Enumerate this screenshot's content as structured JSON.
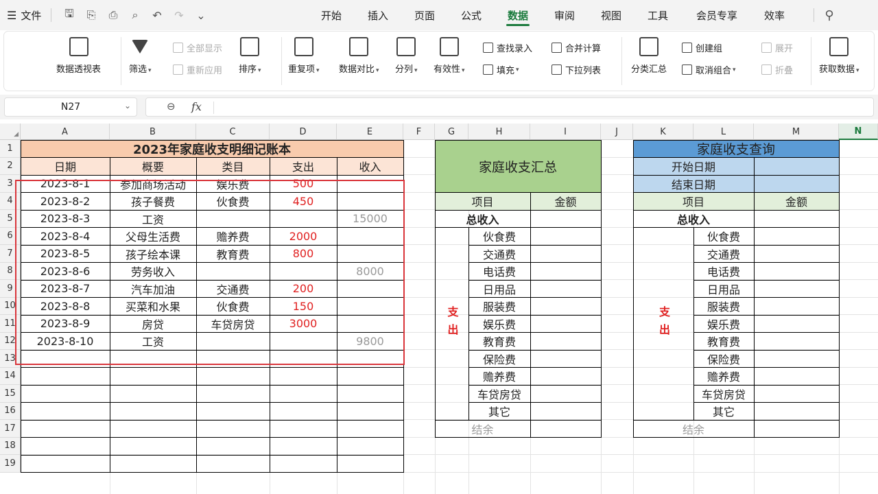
{
  "menubar": {
    "menu_label": "文件",
    "tabs": [
      "开始",
      "插入",
      "页面",
      "公式",
      "数据",
      "审阅",
      "视图",
      "工具",
      "会员专享",
      "效率"
    ],
    "active_tab": "数据"
  },
  "ribbon": {
    "pivot": "数据透视表",
    "filter": "筛选",
    "show_all": "全部显示",
    "reapply": "重新应用",
    "sort": "排序",
    "duplicates": "重复项",
    "compare": "数据对比",
    "split": "分列",
    "validity": "有效性",
    "lookup": "查找录入",
    "fill": "填充",
    "consolidate": "合并计算",
    "dropdown": "下拉列表",
    "subtotal": "分类汇总",
    "group": "创建组",
    "ungroup": "取消组合",
    "expand": "展开",
    "collapse": "折叠",
    "get_data": "获取数据"
  },
  "formula_bar": {
    "name_box": "N27",
    "fx": "fx",
    "formula": ""
  },
  "columns": [
    "A",
    "B",
    "C",
    "D",
    "E",
    "F",
    "G",
    "H",
    "I",
    "J",
    "K",
    "L",
    "M",
    "N"
  ],
  "selected_column": "N",
  "rows": [
    "1",
    "2",
    "3",
    "4",
    "5",
    "6",
    "7",
    "8",
    "9",
    "10",
    "11",
    "12",
    "13",
    "14",
    "15",
    "16",
    "17",
    "18",
    "19"
  ],
  "ledger": {
    "title": "2023年家庭收支明细记账本",
    "headers": [
      "日期",
      "概要",
      "类目",
      "支出",
      "收入"
    ],
    "entries": [
      [
        "2023-8-1",
        "参加商场活动",
        "娱乐费",
        "500",
        ""
      ],
      [
        "2023-8-2",
        "孩子餐费",
        "伙食费",
        "450",
        ""
      ],
      [
        "2023-8-3",
        "工资",
        "",
        "",
        "15000"
      ],
      [
        "2023-8-4",
        "父母生活费",
        "赡养费",
        "2000",
        ""
      ],
      [
        "2023-8-5",
        "孩子绘本课",
        "教育费",
        "800",
        ""
      ],
      [
        "2023-8-6",
        "劳务收入",
        "",
        "",
        "8000"
      ],
      [
        "2023-8-7",
        "汽车加油",
        "交通费",
        "200",
        ""
      ],
      [
        "2023-8-8",
        "买菜和水果",
        "伙食费",
        "150",
        ""
      ],
      [
        "2023-8-9",
        "房贷",
        "车贷房贷",
        "3000",
        ""
      ],
      [
        "2023-8-10",
        "工资",
        "",
        "",
        "9800"
      ]
    ]
  },
  "summary": {
    "title": "家庭收支汇总",
    "col_item": "项目",
    "col_amount": "金额",
    "total_income": "总收入",
    "expense_label": "支出",
    "categories": [
      "伙食费",
      "交通费",
      "电话费",
      "日用品",
      "服装费",
      "娱乐费",
      "教育费",
      "保险费",
      "赡养费",
      "车贷房贷",
      "其它"
    ],
    "balance": "结余"
  },
  "query": {
    "title": "家庭收支查询",
    "start_date": "开始日期",
    "end_date": "结束日期",
    "col_item": "项目",
    "col_amount": "金额",
    "total_income": "总收入",
    "expense_label": "支出",
    "categories": [
      "伙食费",
      "交通费",
      "电话费",
      "日用品",
      "服装费",
      "娱乐费",
      "教育费",
      "保险费",
      "赡养费",
      "车贷房贷",
      "其它"
    ],
    "balance": "结余"
  },
  "colors": {
    "ledger_header": "#f8cbad",
    "ledger_subheader": "#fce4d6",
    "summary_title": "#a9d18e",
    "summary_subheader": "#e2efda",
    "query_title": "#5b9bd5",
    "query_subheader": "#bdd7ee",
    "expense_red": "#e02020",
    "income_gray": "#999999",
    "accent_green": "#1a7a3c",
    "highlight_box": "#d9343a"
  }
}
